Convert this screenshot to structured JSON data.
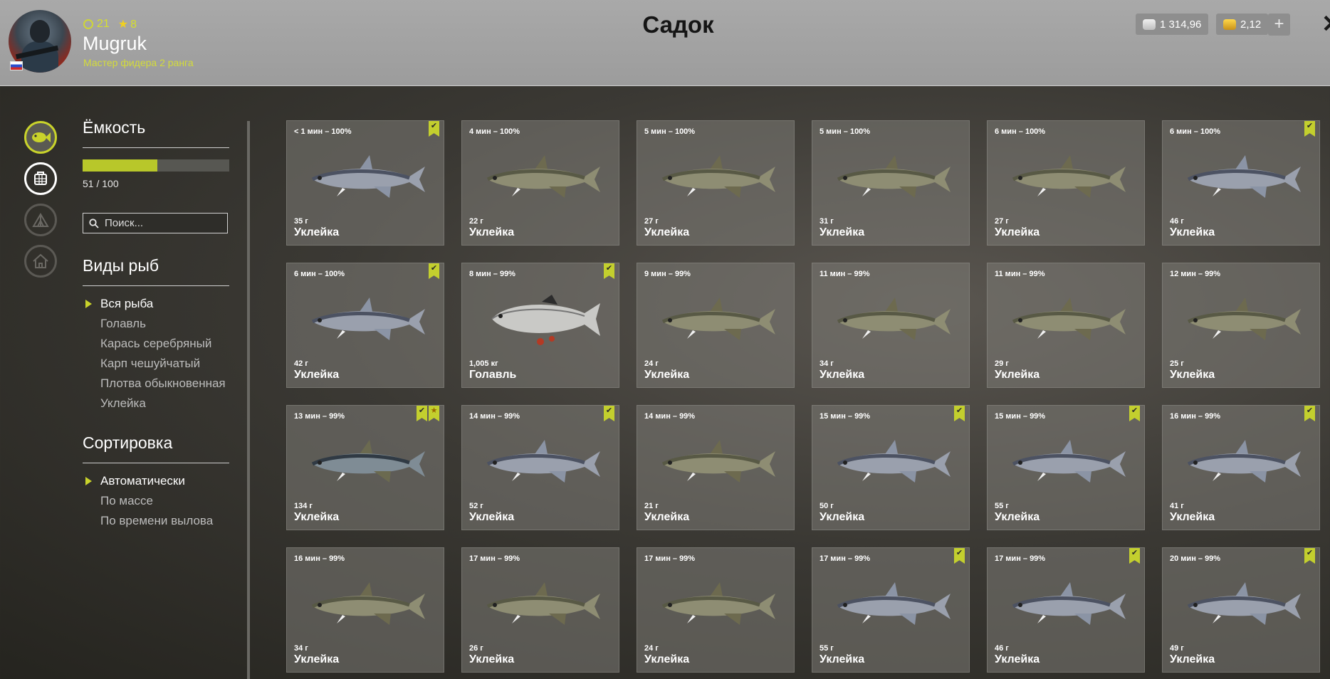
{
  "header": {
    "player": {
      "level": "21",
      "stars": "8",
      "username": "Mugruk",
      "rank": "Мастер фидера 2 ранга"
    },
    "title": "Садок",
    "silver": "1 314,96",
    "gold": "2,12",
    "plus_label": "+",
    "close_label": "✕"
  },
  "sidebar": {
    "capacity": {
      "heading": "Ёмкость",
      "value": "51 / 100",
      "fill": 0.51
    },
    "search": {
      "placeholder": "Поиск..."
    },
    "species": {
      "heading": "Виды рыб",
      "items": [
        "Вся рыба",
        "Голавль",
        "Карась серебряный",
        "Карп чешуйчатый",
        "Плотва обыкновенная",
        "Уклейка"
      ],
      "selected": 0
    },
    "sort": {
      "heading": "Сортировка",
      "items": [
        "Автоматически",
        "По массе",
        "По времени вылова"
      ],
      "selected": 0
    }
  },
  "nav_icons": [
    "fish-icon",
    "keepnet-icon",
    "tent-icon",
    "house-icon"
  ],
  "accent_color": "#c9d32b",
  "catches": [
    {
      "time": "< 1 мин – 100%",
      "weight": "35 г",
      "name": "Уклейка",
      "marked": true,
      "starred": false,
      "variant": "blue"
    },
    {
      "time": "4 мин – 100%",
      "weight": "22 г",
      "name": "Уклейка",
      "marked": false,
      "starred": false,
      "variant": "olive"
    },
    {
      "time": "5 мин – 100%",
      "weight": "27 г",
      "name": "Уклейка",
      "marked": false,
      "starred": false,
      "variant": "olive"
    },
    {
      "time": "5 мин – 100%",
      "weight": "31 г",
      "name": "Уклейка",
      "marked": false,
      "starred": false,
      "variant": "olive"
    },
    {
      "time": "6 мин – 100%",
      "weight": "27 г",
      "name": "Уклейка",
      "marked": false,
      "starred": false,
      "variant": "olive"
    },
    {
      "time": "6 мин – 100%",
      "weight": "46 г",
      "name": "Уклейка",
      "marked": true,
      "starred": false,
      "variant": "blue"
    },
    {
      "time": "6 мин – 100%",
      "weight": "42 г",
      "name": "Уклейка",
      "marked": true,
      "starred": false,
      "variant": "blue"
    },
    {
      "time": "8 мин – 99%",
      "weight": "1,005 кг",
      "name": "Голавль",
      "marked": true,
      "starred": false,
      "variant": "chub"
    },
    {
      "time": "9 мин – 99%",
      "weight": "24 г",
      "name": "Уклейка",
      "marked": false,
      "starred": false,
      "variant": "olive"
    },
    {
      "time": "11 мин – 99%",
      "weight": "34 г",
      "name": "Уклейка",
      "marked": false,
      "starred": false,
      "variant": "olive"
    },
    {
      "time": "11 мин – 99%",
      "weight": "29 г",
      "name": "Уклейка",
      "marked": false,
      "starred": false,
      "variant": "olive"
    },
    {
      "time": "12 мин – 99%",
      "weight": "25 г",
      "name": "Уклейка",
      "marked": false,
      "starred": false,
      "variant": "olive"
    },
    {
      "time": "13 мин – 99%",
      "weight": "134 г",
      "name": "Уклейка",
      "marked": true,
      "starred": true,
      "variant": "big"
    },
    {
      "time": "14 мин – 99%",
      "weight": "52 г",
      "name": "Уклейка",
      "marked": true,
      "starred": false,
      "variant": "blue"
    },
    {
      "time": "14 мин – 99%",
      "weight": "21 г",
      "name": "Уклейка",
      "marked": false,
      "starred": false,
      "variant": "olive"
    },
    {
      "time": "15 мин – 99%",
      "weight": "50 г",
      "name": "Уклейка",
      "marked": true,
      "starred": false,
      "variant": "blue"
    },
    {
      "time": "15 мин – 99%",
      "weight": "55 г",
      "name": "Уклейка",
      "marked": true,
      "starred": false,
      "variant": "blue"
    },
    {
      "time": "16 мин – 99%",
      "weight": "41 г",
      "name": "Уклейка",
      "marked": true,
      "starred": false,
      "variant": "blue"
    },
    {
      "time": "16 мин – 99%",
      "weight": "34 г",
      "name": "Уклейка",
      "marked": false,
      "starred": false,
      "variant": "olive"
    },
    {
      "time": "17 мин – 99%",
      "weight": "26 г",
      "name": "Уклейка",
      "marked": false,
      "starred": false,
      "variant": "olive"
    },
    {
      "time": "17 мин – 99%",
      "weight": "24 г",
      "name": "Уклейка",
      "marked": false,
      "starred": false,
      "variant": "olive"
    },
    {
      "time": "17 мин – 99%",
      "weight": "55 г",
      "name": "Уклейка",
      "marked": true,
      "starred": false,
      "variant": "blue"
    },
    {
      "time": "17 мин – 99%",
      "weight": "46 г",
      "name": "Уклейка",
      "marked": true,
      "starred": false,
      "variant": "blue"
    },
    {
      "time": "20 мин – 99%",
      "weight": "49 г",
      "name": "Уклейка",
      "marked": true,
      "starred": false,
      "variant": "blue"
    }
  ]
}
